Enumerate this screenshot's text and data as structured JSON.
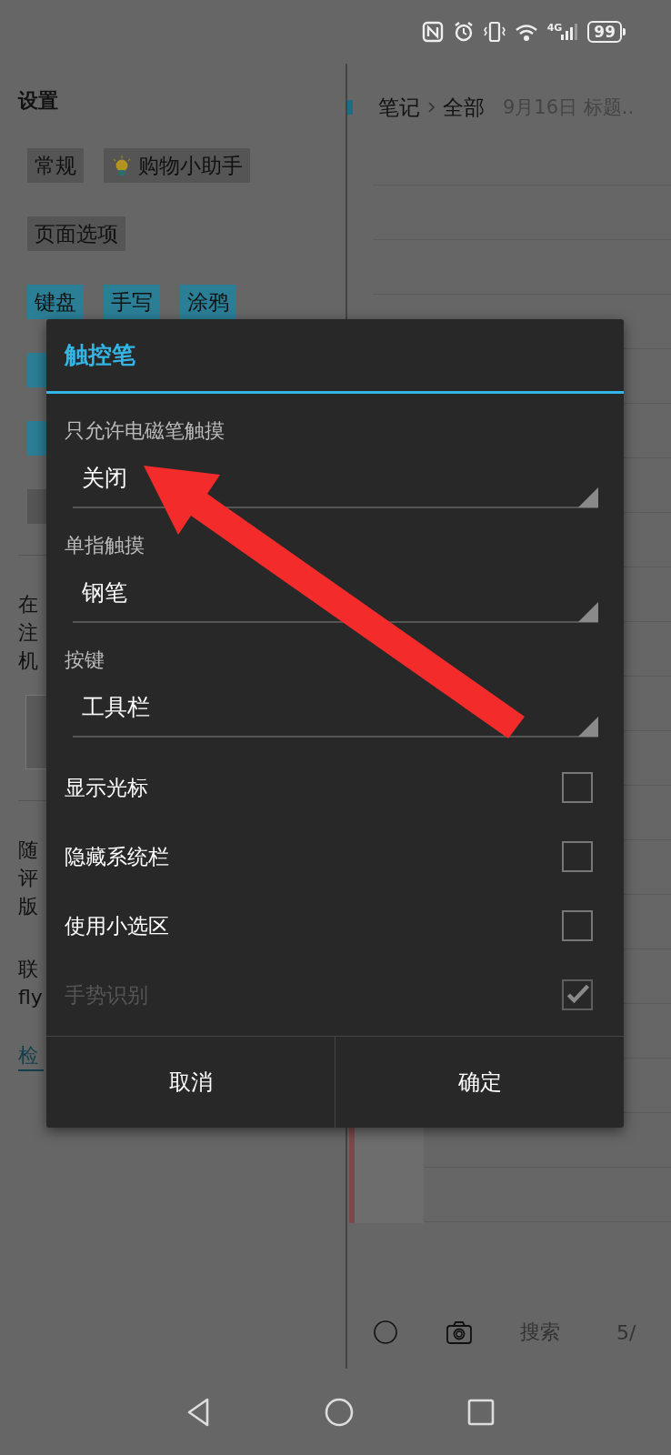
{
  "status_bar": {
    "network": "4G",
    "battery": "99"
  },
  "settings": {
    "title": "设置",
    "items": [
      {
        "kind": "tags",
        "tags": [
          {
            "text": "常规",
            "kind": "plain"
          },
          {
            "text": "购物小助手",
            "kind": "tip"
          }
        ]
      },
      {
        "kind": "tags",
        "tags": [
          {
            "text": "页面选项",
            "kind": "plain"
          }
        ]
      },
      {
        "kind": "tags",
        "tags": [
          {
            "text": "键盘",
            "kind": "accent"
          },
          {
            "text": "手写",
            "kind": "accent"
          },
          {
            "text": "涂鸦",
            "kind": "accent"
          }
        ]
      },
      {
        "kind": "tags",
        "tags": [
          {
            "kind": "accent"
          }
        ]
      },
      {
        "kind": "tags",
        "tags": [
          {
            "kind": "accent"
          }
        ]
      },
      {
        "kind": "tags",
        "tags": [
          {
            "kind": "plain"
          }
        ]
      },
      {
        "kind": "divider"
      },
      {
        "kind": "paragraph",
        "lines": [
          "在",
          "注",
          "机"
        ]
      },
      {
        "kind": "block"
      },
      {
        "kind": "divider"
      },
      {
        "kind": "paragraph",
        "lines": [
          "随",
          "评",
          "版"
        ]
      },
      {
        "kind": "paragraph",
        "lines": [
          "联",
          "fly"
        ]
      },
      {
        "kind": "link",
        "text": "检"
      }
    ]
  },
  "notes": {
    "breadcrumb": [
      "笔记",
      "全部"
    ],
    "title": "9月16日 标题..",
    "toolbar": {
      "search": "搜索",
      "page": "5/"
    }
  },
  "dialog": {
    "title": "触控笔",
    "options": [
      {
        "kind": "spinner",
        "label": "只允许电磁笔触摸",
        "value": "关闭"
      },
      {
        "kind": "spinner",
        "label": "单指触摸",
        "value": "钢笔"
      },
      {
        "kind": "spinner",
        "label": "按键",
        "value": "工具栏"
      },
      {
        "kind": "checkbox",
        "label": "显示光标",
        "checked": false,
        "disabled": false
      },
      {
        "kind": "checkbox",
        "label": "隐藏系统栏",
        "checked": false,
        "disabled": false
      },
      {
        "kind": "checkbox",
        "label": "使用小选区",
        "checked": false,
        "disabled": false
      },
      {
        "kind": "checkbox",
        "label": "手势识别",
        "checked": true,
        "disabled": true
      }
    ],
    "buttons": [
      "取消",
      "确定"
    ]
  }
}
